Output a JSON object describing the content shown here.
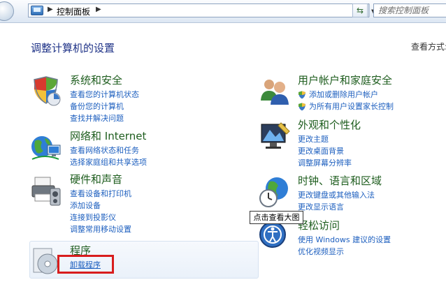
{
  "address_bar": {
    "breadcrumb": "控制面板",
    "icon": "control-panel-icon",
    "search_placeholder": "搜索控制面板"
  },
  "page": {
    "title": "调整计算机的设置",
    "view_by": "查看方式:"
  },
  "categories": {
    "system_security": {
      "title": "系统和安全",
      "icon": "security-shield-icon",
      "links": [
        "查看您的计算机状态",
        "备份您的计算机",
        "查找并解决问题"
      ]
    },
    "network": {
      "title": "网络和 Internet",
      "icon": "network-globe-icon",
      "links": [
        "查看网络状态和任务",
        "选择家庭组和共享选项"
      ]
    },
    "hardware": {
      "title": "硬件和声音",
      "icon": "printer-icon",
      "links": [
        "查看设备和打印机",
        "添加设备",
        "连接到投影仪",
        "调整常用移动设置"
      ]
    },
    "programs": {
      "title": "程序",
      "icon": "programs-disc-icon",
      "links": [
        "卸载程序"
      ]
    },
    "user_accounts": {
      "title": "用户帐户和家庭安全",
      "icon": "users-icon",
      "links": [
        "添加或删除用户帐户",
        "为所有用户设置家长控制"
      ]
    },
    "appearance": {
      "title": "外观和个性化",
      "icon": "display-icon",
      "links": [
        "更改主题",
        "更改桌面背景",
        "调整屏幕分辨率"
      ]
    },
    "clock": {
      "title": "时钟、语言和区域",
      "icon": "clock-globe-icon",
      "links": [
        "更改键盘或其他输入法",
        "更改显示语言"
      ]
    },
    "ease": {
      "title": "轻松访问",
      "icon": "ease-of-access-icon",
      "links": [
        "使用 Windows 建议的设置",
        "优化视频显示"
      ]
    }
  },
  "tooltip": "点击查看大图",
  "colors": {
    "title_blue": "#1e3287",
    "category_green": "#1e5d1e",
    "link_blue": "#1d5fbf",
    "highlight_red": "#d81d1d"
  }
}
